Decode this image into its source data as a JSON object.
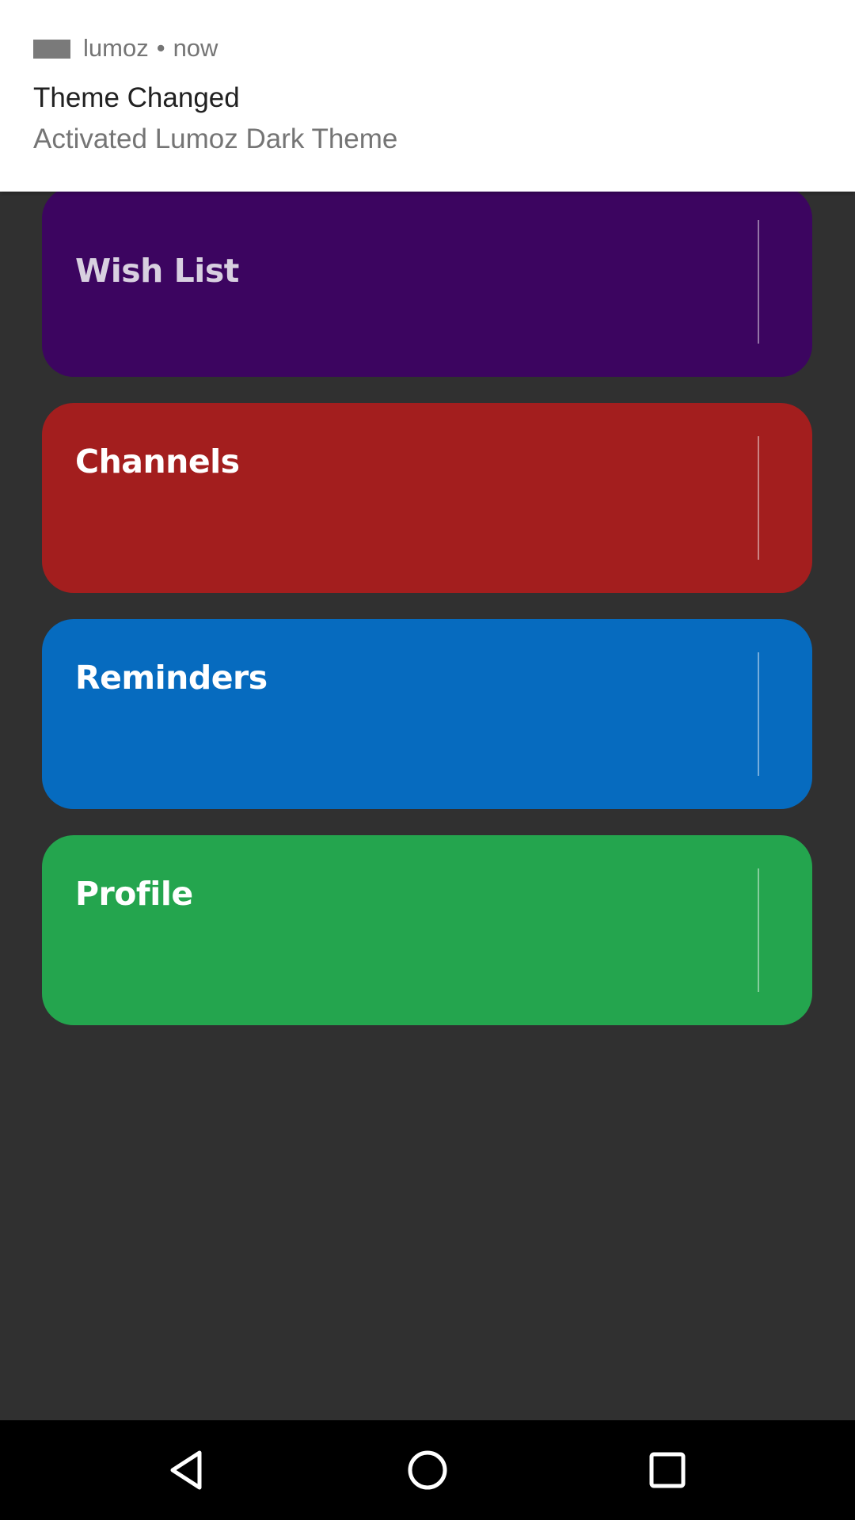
{
  "notification": {
    "app_name": "lumoz",
    "separator": "•",
    "time": "now",
    "title": "Theme Changed",
    "text": "Activated Lumoz Dark Theme"
  },
  "cards": [
    {
      "label": "Wish List",
      "color": "#3c0560"
    },
    {
      "label": "Channels",
      "color": "#a31e1e"
    },
    {
      "label": "Reminders",
      "color": "#066bbf"
    },
    {
      "label": "Profile",
      "color": "#24a54e"
    }
  ],
  "colors": {
    "background": "#303030",
    "notification_bg": "#ffffff",
    "navbar": "#000000"
  },
  "navbar": {
    "icons": [
      "back-icon",
      "home-icon",
      "recents-icon"
    ]
  }
}
